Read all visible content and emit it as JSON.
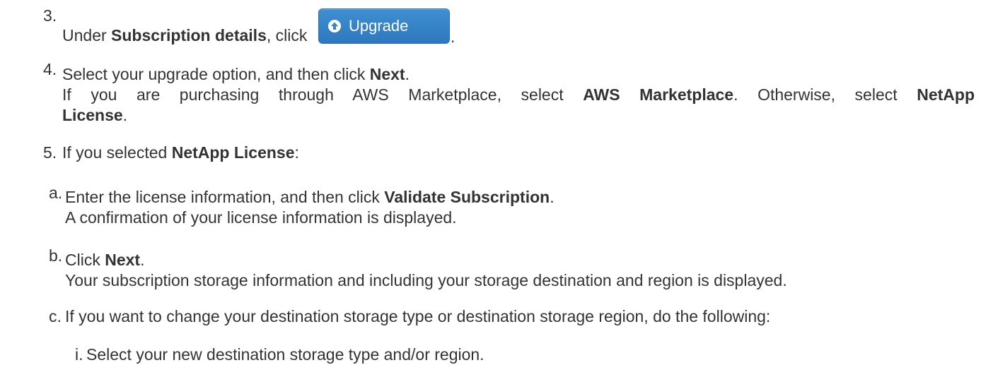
{
  "steps": {
    "s3": {
      "number": "3.",
      "prefix": "Under ",
      "bold": "Subscription details",
      "mid": ", click ",
      "button_label": "Upgrade",
      "suffix": "."
    },
    "s4": {
      "number": "4.",
      "line1_prefix": "Select your upgrade option, and then click ",
      "line1_bold": "Next",
      "line1_suffix": ".",
      "line2_prefix": "If you are purchasing through AWS Marketplace, select ",
      "line2_bold1": "AWS Marketplace",
      "line2_mid": ". Otherwise, select ",
      "line2_bold2": "NetApp",
      "line3_bold": "License",
      "line3_suffix": "."
    },
    "s5": {
      "number": "5.",
      "prefix": "If you selected ",
      "bold": "NetApp License",
      "suffix": ":",
      "sub": {
        "a": {
          "letter": "a.",
          "line1_prefix": "Enter the license information, and then click ",
          "line1_bold": "Validate Subscription",
          "line1_suffix": ".",
          "line2": "A confirmation of your license information is displayed."
        },
        "b": {
          "letter": "b.",
          "line1_prefix": "Click ",
          "line1_bold": "Next",
          "line1_suffix": ".",
          "line2": "Your subscription storage information and including your storage destination and region is displayed."
        },
        "c": {
          "letter": "c.",
          "text": "If you want to change your destination storage type or destination storage region, do the following:",
          "sub": {
            "i": {
              "letter": "i.",
              "text": "Select your new destination storage type and/or region."
            }
          }
        }
      }
    }
  }
}
